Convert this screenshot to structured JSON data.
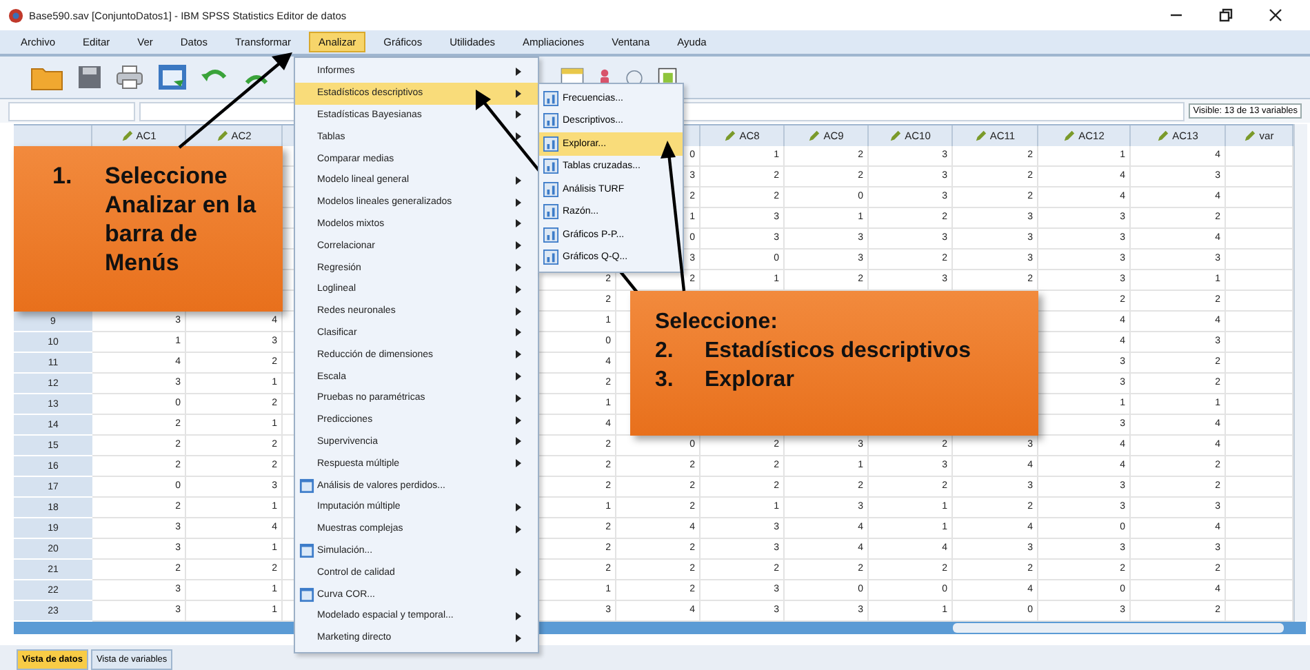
{
  "window": {
    "title": "Base590.sav [ConjuntoDatos1] - IBM SPSS Statistics Editor de datos"
  },
  "menubar": [
    {
      "label": "Archivo",
      "selected": false
    },
    {
      "label": "Editar",
      "selected": false
    },
    {
      "label": "Ver",
      "selected": false
    },
    {
      "label": "Datos",
      "selected": false
    },
    {
      "label": "Transformar",
      "selected": false
    },
    {
      "label": "Analizar",
      "selected": true
    },
    {
      "label": "Gráficos",
      "selected": false
    },
    {
      "label": "Utilidades",
      "selected": false
    },
    {
      "label": "Ampliaciones",
      "selected": false
    },
    {
      "label": "Ventana",
      "selected": false
    },
    {
      "label": "Ayuda",
      "selected": false
    }
  ],
  "visible_variables": "Visible: 13 de 13 variables",
  "grid": {
    "columns": [
      "AC1",
      "AC2",
      null,
      null,
      null,
      null,
      null,
      "AC8",
      "AC9",
      "AC10",
      "AC11",
      "AC12",
      "AC13",
      "var"
    ],
    "rows": [
      {
        "number": null,
        "cells": [
          null,
          null,
          null,
          null,
          null,
          null,
          "0",
          "1",
          "2",
          "3",
          "2",
          "1",
          "4"
        ]
      },
      {
        "number": null,
        "cells": [
          null,
          null,
          null,
          null,
          null,
          null,
          "3",
          "2",
          "2",
          "3",
          "2",
          "4",
          "3"
        ]
      },
      {
        "number": null,
        "cells": [
          null,
          null,
          null,
          null,
          null,
          null,
          "2",
          "2",
          "0",
          "3",
          "2",
          "4",
          "4"
        ]
      },
      {
        "number": null,
        "cells": [
          null,
          null,
          null,
          null,
          null,
          null,
          "1",
          "3",
          "1",
          "2",
          "3",
          "3",
          "2"
        ]
      },
      {
        "number": null,
        "cells": [
          null,
          null,
          null,
          null,
          null,
          null,
          "0",
          "3",
          "3",
          "3",
          "3",
          "3",
          "4"
        ]
      },
      {
        "number": null,
        "cells": [
          null,
          null,
          null,
          null,
          null,
          null,
          "3",
          "0",
          "3",
          "2",
          "3",
          "3",
          "3"
        ]
      },
      {
        "number": null,
        "cells": [
          null,
          null,
          null,
          null,
          null,
          "2",
          "2",
          "1",
          "2",
          "3",
          "2",
          "3",
          "1"
        ]
      },
      {
        "number": null,
        "cells": [
          null,
          null,
          null,
          null,
          null,
          "2",
          null,
          null,
          null,
          null,
          null,
          "2",
          "2"
        ]
      },
      {
        "number": "9",
        "cells": [
          "3",
          "4",
          null,
          null,
          null,
          "1",
          null,
          null,
          null,
          null,
          null,
          "4",
          "4"
        ]
      },
      {
        "number": "10",
        "cells": [
          "1",
          "3",
          null,
          null,
          null,
          "0",
          null,
          null,
          null,
          null,
          null,
          "4",
          "3"
        ]
      },
      {
        "number": "11",
        "cells": [
          "4",
          "2",
          null,
          null,
          null,
          "4",
          null,
          null,
          null,
          null,
          null,
          "3",
          "2"
        ]
      },
      {
        "number": "12",
        "cells": [
          "3",
          "1",
          null,
          null,
          null,
          "2",
          null,
          null,
          null,
          null,
          null,
          "3",
          "2"
        ]
      },
      {
        "number": "13",
        "cells": [
          "0",
          "2",
          null,
          null,
          null,
          "1",
          null,
          null,
          null,
          null,
          null,
          "1",
          "1"
        ]
      },
      {
        "number": "14",
        "cells": [
          "2",
          "1",
          null,
          null,
          null,
          "4",
          null,
          null,
          null,
          null,
          null,
          "3",
          "4"
        ]
      },
      {
        "number": "15",
        "cells": [
          "2",
          "2",
          null,
          null,
          null,
          "2",
          "0",
          "2",
          "3",
          "2",
          "3",
          "4",
          "4"
        ]
      },
      {
        "number": "16",
        "cells": [
          "2",
          "2",
          null,
          null,
          null,
          "2",
          "2",
          "2",
          "1",
          "3",
          "4",
          "4",
          "2"
        ]
      },
      {
        "number": "17",
        "cells": [
          "0",
          "3",
          null,
          null,
          null,
          "2",
          "2",
          "2",
          "2",
          "2",
          "3",
          "3",
          "2"
        ]
      },
      {
        "number": "18",
        "cells": [
          "2",
          "1",
          null,
          null,
          null,
          "1",
          "2",
          "1",
          "3",
          "1",
          "2",
          "3",
          "3"
        ]
      },
      {
        "number": "19",
        "cells": [
          "3",
          "4",
          null,
          null,
          null,
          "2",
          "4",
          "3",
          "4",
          "1",
          "4",
          "0",
          "4"
        ]
      },
      {
        "number": "20",
        "cells": [
          "3",
          "1",
          null,
          null,
          null,
          "2",
          "2",
          "3",
          "4",
          "4",
          "3",
          "3",
          "3"
        ]
      },
      {
        "number": "21",
        "cells": [
          "2",
          "2",
          null,
          null,
          null,
          "2",
          "2",
          "2",
          "2",
          "2",
          "2",
          "2",
          "2"
        ]
      },
      {
        "number": "22",
        "cells": [
          "3",
          "1",
          null,
          null,
          null,
          "1",
          "2",
          "3",
          "0",
          "0",
          "4",
          "0",
          "4"
        ]
      },
      {
        "number": "23",
        "cells": [
          "3",
          "1",
          null,
          null,
          null,
          "3",
          "4",
          "3",
          "3",
          "1",
          "0",
          "3",
          "2"
        ]
      }
    ]
  },
  "analyze_menu": [
    {
      "label": "Informes",
      "kind": "submenu",
      "selected": false
    },
    {
      "label": "Estadísticos descriptivos",
      "kind": "submenu",
      "selected": true
    },
    {
      "label": "Estadísticas Bayesianas",
      "kind": "submenu",
      "selected": false
    },
    {
      "label": "Tablas",
      "kind": "submenu",
      "selected": false
    },
    {
      "label": "Comparar medias",
      "kind": "plain",
      "selected": false
    },
    {
      "label": "Modelo lineal general",
      "kind": "submenu",
      "selected": false
    },
    {
      "label": "Modelos lineales generalizados",
      "kind": "submenu",
      "selected": false
    },
    {
      "label": "Modelos mixtos",
      "kind": "submenu",
      "selected": false
    },
    {
      "label": "Correlacionar",
      "kind": "submenu",
      "selected": false
    },
    {
      "label": "Regresión",
      "kind": "submenu",
      "selected": false
    },
    {
      "label": "Loglineal",
      "kind": "submenu",
      "selected": false
    },
    {
      "label": "Redes neuronales",
      "kind": "submenu",
      "selected": false
    },
    {
      "label": "Clasificar",
      "kind": "submenu",
      "selected": false
    },
    {
      "label": "Reducción de dimensiones",
      "kind": "submenu",
      "selected": false
    },
    {
      "label": "Escala",
      "kind": "submenu",
      "selected": false
    },
    {
      "label": "Pruebas no paramétricas",
      "kind": "submenu",
      "selected": false
    },
    {
      "label": "Predicciones",
      "kind": "submenu",
      "selected": false
    },
    {
      "label": "Supervivencia",
      "kind": "submenu",
      "selected": false
    },
    {
      "label": "Respuesta múltiple",
      "kind": "submenu",
      "selected": false
    },
    {
      "label": "Análisis de valores perdidos...",
      "kind": "dialog",
      "selected": false
    },
    {
      "label": "Imputación múltiple",
      "kind": "submenu",
      "selected": false
    },
    {
      "label": "Muestras complejas",
      "kind": "submenu",
      "selected": false
    },
    {
      "label": "Simulación...",
      "kind": "dialog",
      "selected": false
    },
    {
      "label": "Control de calidad",
      "kind": "submenu",
      "selected": false
    },
    {
      "label": "Curva COR...",
      "kind": "dialog",
      "selected": false
    },
    {
      "label": "Modelado espacial y temporal...",
      "kind": "submenu",
      "selected": false
    },
    {
      "label": "Marketing directo",
      "kind": "submenu",
      "selected": false
    }
  ],
  "descriptives_submenu": [
    {
      "label": "Frecuencias...",
      "selected": false
    },
    {
      "label": "Descriptivos...",
      "selected": false
    },
    {
      "label": "Explorar...",
      "selected": true
    },
    {
      "label": "Tablas cruzadas...",
      "selected": false
    },
    {
      "label": "Análisis TURF",
      "selected": false
    },
    {
      "label": "Razón...",
      "selected": false
    },
    {
      "label": "Gráficos P-P...",
      "selected": false
    },
    {
      "label": "Gráficos Q-Q...",
      "selected": false
    }
  ],
  "callouts": [
    {
      "steps": [
        {
          "number": "1.",
          "text": "Seleccione Analizar en la barra de Menús"
        }
      ]
    },
    {
      "heading": "Seleccione:",
      "steps": [
        {
          "number": "2.",
          "text": "Estadísticos descriptivos"
        },
        {
          "number": "3.",
          "text": "Explorar"
        }
      ]
    }
  ],
  "view_tabs": [
    {
      "label": "Vista de datos",
      "selected": true
    },
    {
      "label": "Vista de variables",
      "selected": false
    }
  ]
}
